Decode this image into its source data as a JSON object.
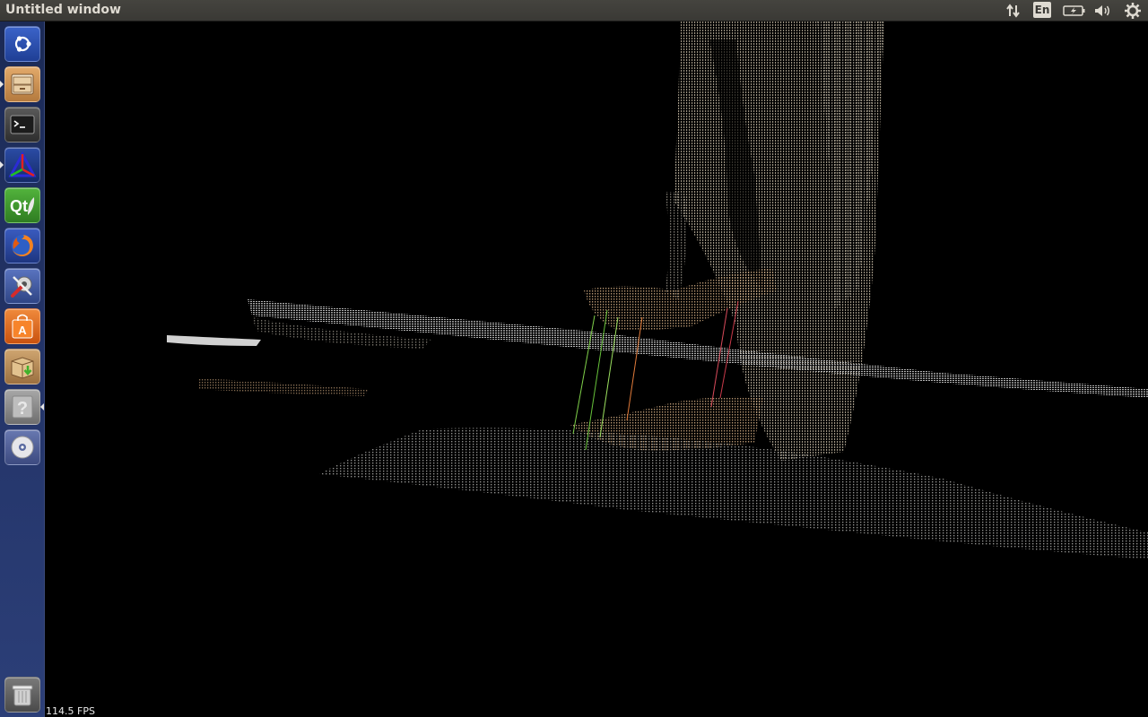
{
  "window": {
    "title": "Untitled window"
  },
  "indicators": {
    "network_icon": "network-updown-icon",
    "keyboard_layout": "En",
    "battery_icon": "battery-icon",
    "sound_icon": "volume-icon",
    "session_icon": "gear-icon"
  },
  "launcher": {
    "items": [
      {
        "name": "dash-home",
        "icon": "ubuntu-logo-icon",
        "color": "#2a4fb0"
      },
      {
        "name": "files",
        "icon": "file-cabinet-icon",
        "color": "#c98d4f"
      },
      {
        "name": "terminal",
        "icon": "terminal-icon",
        "color": "#3b3b3b"
      },
      {
        "name": "3d-app",
        "icon": "colored-triangle-icon",
        "color": "#1e3a8a"
      },
      {
        "name": "qt-creator",
        "icon": "qt-logo-icon",
        "color": "#3f9d2f"
      },
      {
        "name": "firefox",
        "icon": "firefox-icon",
        "color": "#2c4fa8"
      },
      {
        "name": "system-settings",
        "icon": "settings-tools-icon",
        "color": "#4a63a8"
      },
      {
        "name": "software-center",
        "icon": "shopping-bag-icon",
        "color": "#e26a1c"
      },
      {
        "name": "archive-manager",
        "icon": "package-download-icon",
        "color": "#b88a55"
      },
      {
        "name": "help",
        "icon": "question-mark-icon",
        "color": "#8a8a8a"
      },
      {
        "name": "disc",
        "icon": "cd-icon",
        "color": "#5a6aa0"
      },
      {
        "name": "trash",
        "icon": "trash-icon",
        "color": "#6a6a6a"
      }
    ]
  },
  "viewer": {
    "fps_label": "114.5 FPS"
  }
}
